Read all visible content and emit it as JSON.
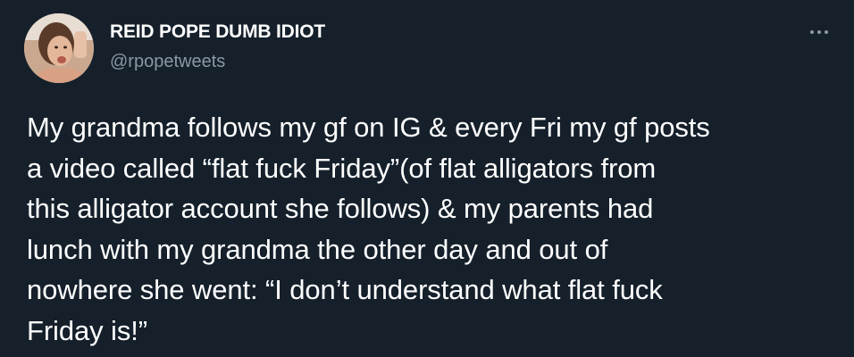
{
  "tweet": {
    "author": {
      "display_name": "REID POPE DUMB IDIOT",
      "handle": "@rpopetweets",
      "avatar_icon": "profile-photo"
    },
    "more_icon": "ellipsis-icon",
    "text_lines": [
      "My grandma follows my gf on IG & every Fri my gf posts",
      "a video called “flat fuck Friday”(of flat alligators from",
      "this alligator account she follows) & my parents had",
      "lunch with my grandma the other day and out of",
      "nowhere she went: “I don’t understand what flat fuck",
      "Friday is!”"
    ]
  },
  "colors": {
    "background": "#15202b",
    "primary_text": "#ffffff",
    "secondary_text": "#8b98a5"
  }
}
